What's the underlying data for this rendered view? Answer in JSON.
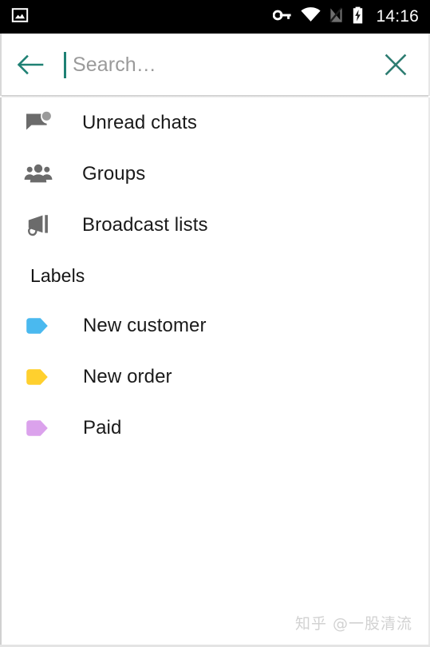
{
  "status_bar": {
    "background": "#000000",
    "clock": "14:16",
    "left_icons": [
      {
        "name": "gallery-icon",
        "label": "Photo"
      }
    ],
    "right_icons": [
      {
        "name": "vpn-key-icon",
        "label": "VPN key"
      },
      {
        "name": "wifi-icon",
        "label": "Wi-Fi connected"
      },
      {
        "name": "signal-off-icon",
        "label": "No mobile signal"
      },
      {
        "name": "battery-charging-icon",
        "label": "Battery charging"
      }
    ]
  },
  "app_bar": {
    "back_label": "Back",
    "close_label": "Close",
    "accent_color": "#1f8174",
    "search": {
      "value": "",
      "placeholder": "Search…"
    }
  },
  "menu": {
    "items": [
      {
        "icon": "mark-chat-unread-icon",
        "label": "Unread chats",
        "icon_color": "#6b6b6b"
      },
      {
        "icon": "groups-icon",
        "label": "Groups",
        "icon_color": "#6b6b6b"
      },
      {
        "icon": "broadcast-icon",
        "label": "Broadcast lists",
        "icon_color": "#6b6b6b"
      }
    ]
  },
  "labels_section": {
    "header": "Labels",
    "items": [
      {
        "label": "New customer",
        "color": "#4ab9ef"
      },
      {
        "label": "New order",
        "color": "#ffd02e"
      },
      {
        "label": "Paid",
        "color": "#dba2ec"
      }
    ]
  },
  "watermark": {
    "text": "知乎 @一股清流"
  }
}
